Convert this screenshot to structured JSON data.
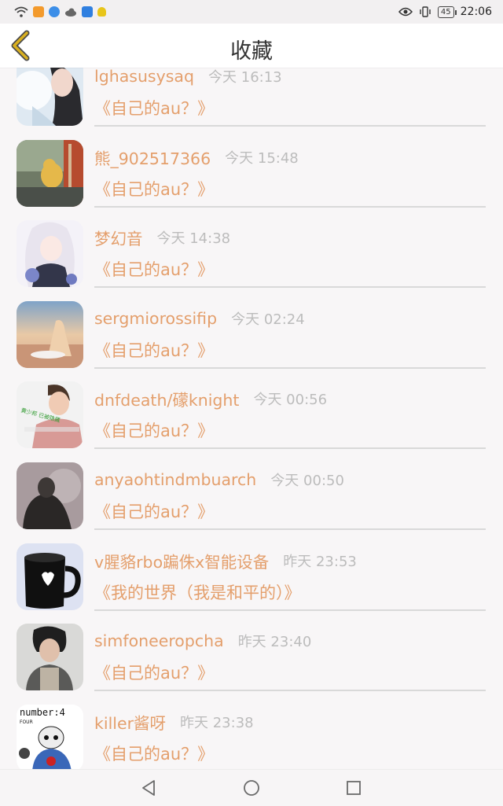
{
  "status_bar": {
    "time": "22:06",
    "battery": "45",
    "icons": [
      "wifi-icon",
      "video-app-icon",
      "browser-app-icon",
      "cloud-icon",
      "app-store-icon",
      "trophy-icon",
      "eye-icon",
      "vibrate-icon",
      "battery-icon"
    ]
  },
  "header": {
    "title": "收藏",
    "back_icon": "chevron-left-icon"
  },
  "items": [
    {
      "name": "lghasusysaq",
      "time": "今天 16:13",
      "topic": "《自己的au？》"
    },
    {
      "name": "熊_902517366",
      "time": "今天 15:48",
      "topic": "《自己的au？》"
    },
    {
      "name": "梦幻音",
      "time": "今天 14:38",
      "topic": "《自己的au？》"
    },
    {
      "name": "sergmiorossifip",
      "time": "今天 02:24",
      "topic": "《自己的au？》"
    },
    {
      "name": "dnfdeath/礞knight",
      "time": "今天 00:56",
      "topic": "《自己的au？》"
    },
    {
      "name": "anyaohtindmbuarch",
      "time": "今天 00:50",
      "topic": "《自己的au？》"
    },
    {
      "name": "v腥貉rbo蹁侏x智能设备",
      "time": "昨天 23:53",
      "topic": "《我的世界（我是和平的）》"
    },
    {
      "name": "simfoneeropcha",
      "time": "昨天 23:40",
      "topic": "《自己的au？》"
    },
    {
      "name": "killer酱呀",
      "time": "昨天 23:38",
      "topic": "《自己的au？》"
    }
  ],
  "avatar_texts": {
    "dnf": "黄少邦 已被隐藏",
    "killer_line1": "number:4",
    "killer_line2": "FOUR"
  },
  "nav_bar": {
    "icons": [
      "back-triangle-icon",
      "home-circle-icon",
      "recents-square-icon"
    ]
  },
  "colors": {
    "accent": "#e49f6c",
    "time": "#bcbcbc",
    "divider": "#d9d9d9",
    "back_arrow": "#d9b020"
  }
}
